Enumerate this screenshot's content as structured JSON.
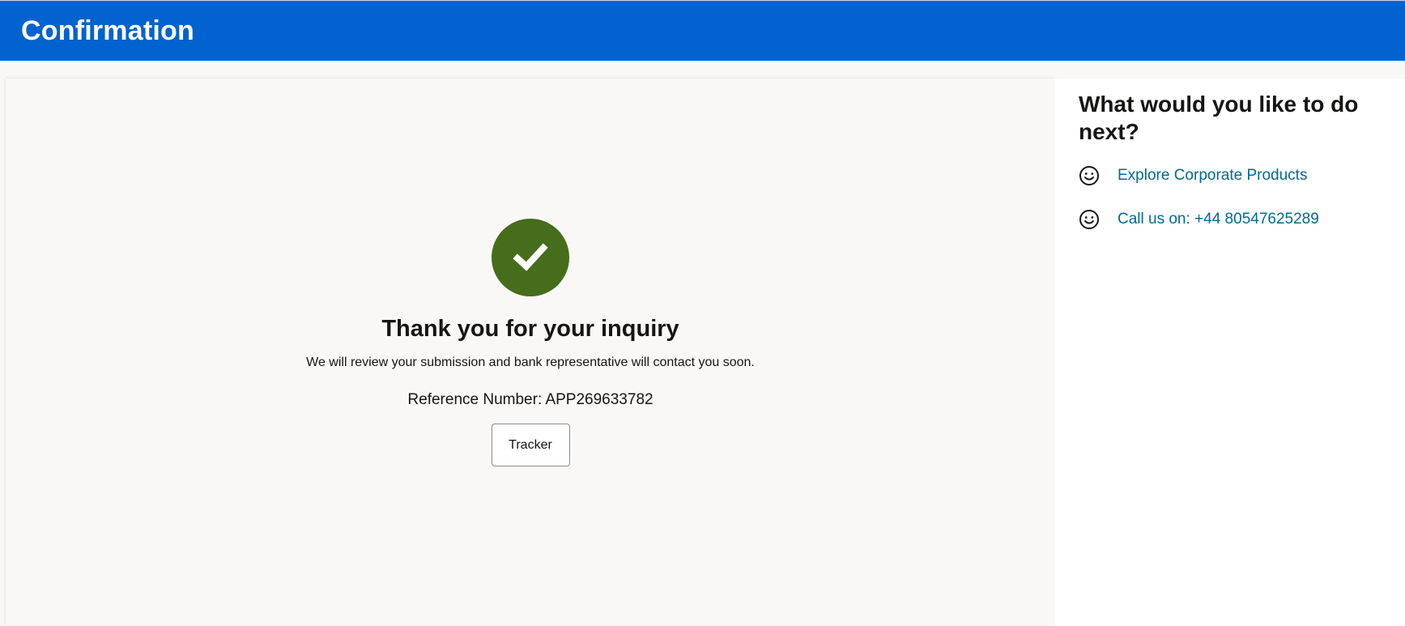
{
  "header": {
    "title": "Confirmation"
  },
  "confirmation": {
    "icon": "checkmark-circle-icon",
    "title": "Thank you for your inquiry",
    "subtitle": "We will review your submission and bank representative will contact you soon.",
    "reference_label": "Reference Number:",
    "reference_number": "APP269633782",
    "tracker_label": "Tracker"
  },
  "sidebar": {
    "title": "What would you like to do next?",
    "links": [
      {
        "icon": "smiley-icon",
        "label": "Explore Corporate Products"
      },
      {
        "icon": "smiley-icon",
        "label": "Call us on: +44 80547625289"
      }
    ]
  },
  "colors": {
    "header_bg": "#0063cf",
    "success_green": "#456d1c",
    "link": "#006b8f"
  }
}
